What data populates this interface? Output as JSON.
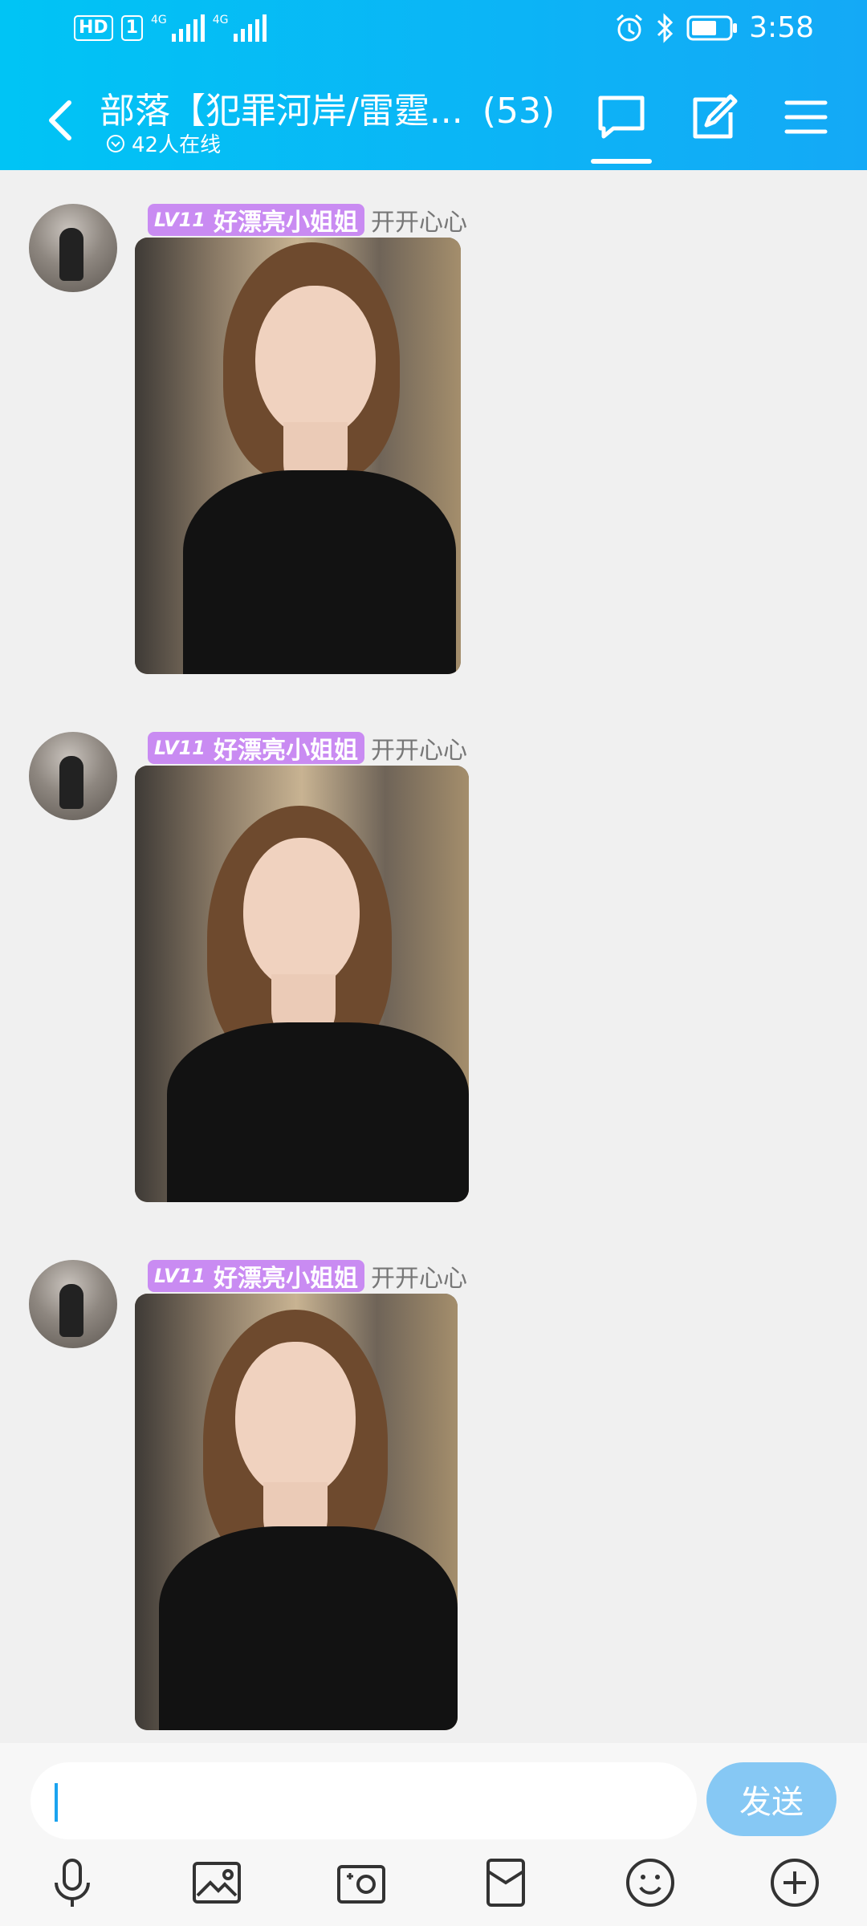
{
  "status_bar": {
    "hd_label": "HD",
    "sim_label": "1",
    "net1": "4G",
    "net2": "4G",
    "time": "3:58"
  },
  "header": {
    "title": "部落【犯罪河岸/雷霆...",
    "member_count": "(53)",
    "online_text": "42人在线"
  },
  "messages": [
    {
      "level": "LV11",
      "nickname": "好漂亮小姐姐",
      "sub_name": "开开心心",
      "content_type": "image"
    },
    {
      "level": "LV11",
      "nickname": "好漂亮小姐姐",
      "sub_name": "开开心心",
      "content_type": "image"
    },
    {
      "level": "LV11",
      "nickname": "好漂亮小姐姐",
      "sub_name": "开开心心",
      "content_type": "image"
    }
  ],
  "input": {
    "value": "",
    "send_label": "发送"
  },
  "colors": {
    "header_start": "#00c4f5",
    "header_end": "#14a9f6",
    "level_badge": "#c98bf2",
    "send_button": "#86c8f4"
  },
  "icons": {
    "header_right": [
      "chat-icon",
      "edit-icon",
      "menu-icon"
    ],
    "toolbar": [
      "mic-icon",
      "image-icon",
      "camera-icon",
      "red-packet-icon",
      "emoji-icon",
      "plus-icon"
    ]
  }
}
